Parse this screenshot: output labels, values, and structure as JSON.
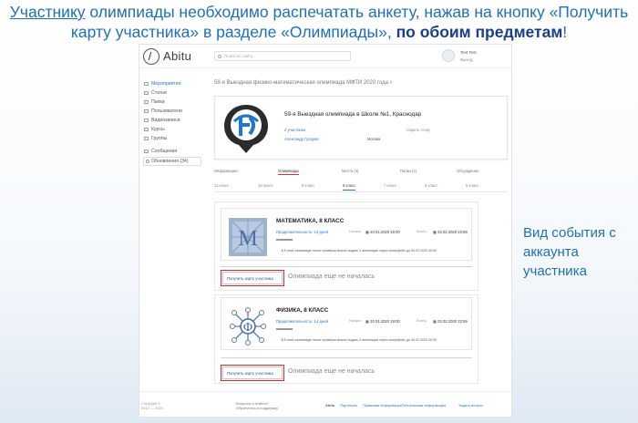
{
  "slide": {
    "headline_part1": "Участнику",
    "headline_part2": " олимпиады необходимо распечатать анкету, нажав на кнопку «Получить карту участника» в разделе «Олимпиады», ",
    "headline_bold": "по обоим предметам",
    "headline_end": "!",
    "side_note": "Вид события с аккаунта участника",
    "accent_color": "#1f6fb5"
  },
  "app": {
    "logo": "Abitu",
    "search_placeholder": "Поиск по сайту",
    "user_name": "Test Test",
    "logout": "Выход"
  },
  "sidebar": {
    "items": [
      {
        "label": "Мероприятия",
        "icon": "events-icon"
      },
      {
        "label": "Статьи",
        "icon": "articles-icon"
      },
      {
        "label": "Папки",
        "icon": "folder-icon"
      },
      {
        "label": "Пользователи",
        "icon": "users-icon"
      },
      {
        "label": "Видеозаписи",
        "icon": "video-icon"
      },
      {
        "label": "Курсы",
        "icon": "courses-icon"
      },
      {
        "label": "Группы",
        "icon": "groups-icon"
      }
    ],
    "messages": "Сообщения",
    "updates": "Обновления (34)"
  },
  "event": {
    "title": "59-я Выездная физико-математическая олимпиада МФТИ 2020 года",
    "name": "59-я Выездная олимпиада в Школе №1, Краснодар",
    "participants": "2 участника",
    "hide": "Скрыть точку",
    "person": "Александр Гусарев",
    "city": "Москва"
  },
  "tabs": [
    "Информация",
    "Олимпиады",
    "Места (4)",
    "Папки (2)",
    "Обсуждение"
  ],
  "grades": [
    "11 класс",
    "10 класс",
    "9 класс",
    "8 класс",
    "7 класс",
    "6 класс",
    "5 класс"
  ],
  "subjects": [
    {
      "title": "МАТЕМАТИКА, 8 КЛАСС",
      "duration": "Продолжительность: 14 дней",
      "start_label": "Начало",
      "start": "20.01.2020 19:00",
      "end_label": "Конец",
      "end": "02.02.2020 23:59",
      "note": "В этой олимпиаде после проверки можно подать 3 апелляции через интерфейс до 05.02.2020 00:00",
      "button": "Получить карту участника",
      "status": "Олимпиада еще не началась"
    },
    {
      "title": "ФИЗИКА, 8 КЛАСС",
      "duration": "Продолжительность: 14 дней",
      "start_label": "Начало",
      "start": "20.01.2020 19:00",
      "end_label": "Конец",
      "end": "02.02.2020 22:59",
      "note": "В этой олимпиаде после проверки можно подать 3 апелляции через интерфейс до 05.02.2020 00:00",
      "button": "Получить карту участника",
      "status": "Олимпиада еще не началась"
    }
  ],
  "footer": {
    "copyright": "Copyright ©",
    "years": "2012 — 2020",
    "help_q": "Вопросы и ответы?",
    "help_link": "Обратитесь в поддержку",
    "partners_logo": "Abitu",
    "links": [
      "Партнеры",
      "Правовая информация",
      "Техническая информация",
      "Задать вопрос"
    ]
  }
}
